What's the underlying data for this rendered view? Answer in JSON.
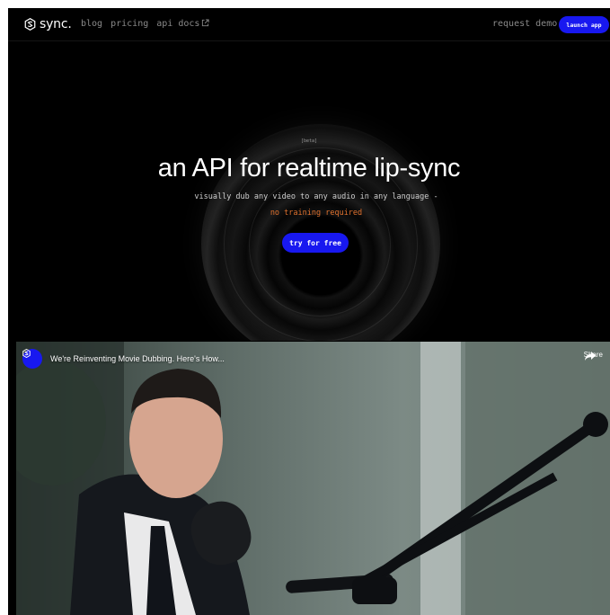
{
  "nav": {
    "logo_text": "sync.",
    "links": [
      "blog",
      "pricing",
      "api docs"
    ],
    "request_demo": "request demo",
    "launch_app": "launch app"
  },
  "hero": {
    "tag": "[beta]",
    "headline": "an API for realtime lip-sync",
    "subtitle_line1": "visually dub any video to any audio in any language -",
    "subtitle_line2": "no training required",
    "cta": "try for free"
  },
  "video": {
    "title": "We're Reinventing Movie Dubbing. Here's How...",
    "share_label": "Share"
  },
  "colors": {
    "accent": "#1818f0",
    "highlight": "#e1722f",
    "background": "#000000"
  }
}
